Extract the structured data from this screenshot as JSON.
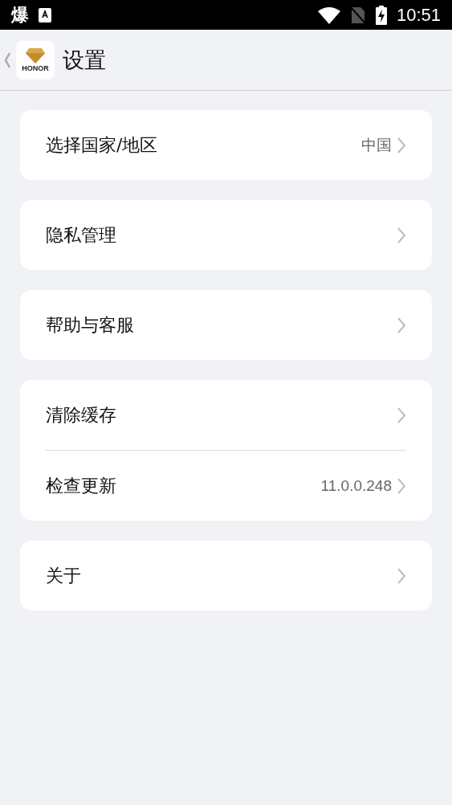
{
  "status_bar": {
    "notification": "爆",
    "time": "10:51"
  },
  "header": {
    "logo_text": "HONOR",
    "title": "设置"
  },
  "groups": [
    {
      "items": [
        {
          "label": "选择国家/地区",
          "value": "中国"
        }
      ]
    },
    {
      "items": [
        {
          "label": "隐私管理"
        }
      ]
    },
    {
      "items": [
        {
          "label": "帮助与客服"
        }
      ]
    },
    {
      "items": [
        {
          "label": "清除缓存"
        },
        {
          "label": "检查更新",
          "value": "11.0.0.248"
        }
      ]
    },
    {
      "items": [
        {
          "label": "关于"
        }
      ]
    }
  ]
}
